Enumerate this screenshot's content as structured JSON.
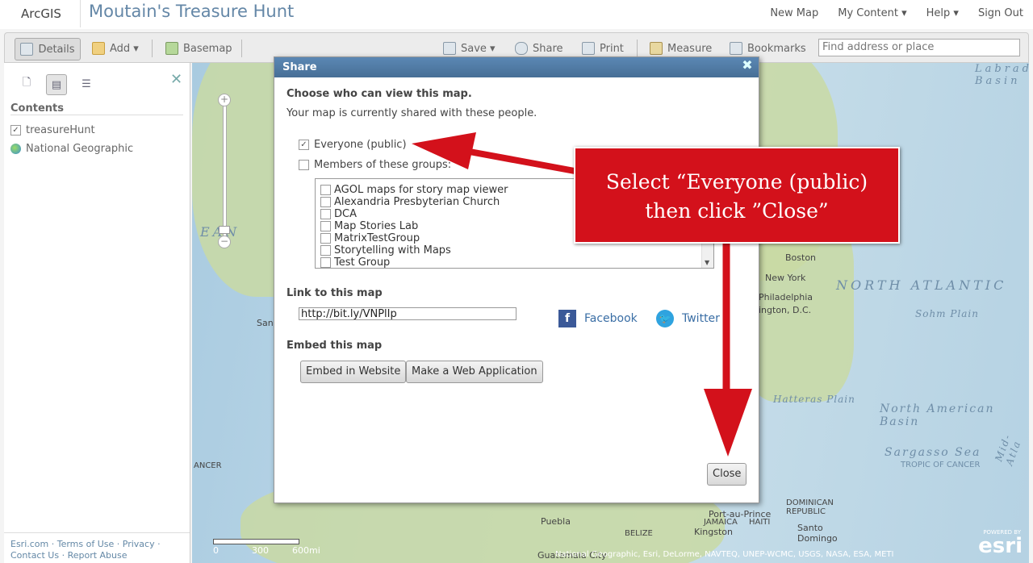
{
  "app": {
    "logo": "ArcGIS",
    "title": "Moutain's Treasure Hunt"
  },
  "topnav": [
    "New Map",
    "My Content ▾",
    "Help ▾",
    "Sign Out"
  ],
  "toolbar": {
    "details": "Details",
    "add": "Add ▾",
    "basemap": "Basemap",
    "save": "Save ▾",
    "share": "Share",
    "print": "Print",
    "measure": "Measure",
    "bookmarks": "Bookmarks",
    "search_placeholder": "Find address or place"
  },
  "sidebar": {
    "contents_heading": "Contents",
    "layers": [
      "treasureHunt",
      "National Geographic"
    ],
    "footer_line1": "Esri.com · Terms of Use · Privacy ·",
    "footer_line2": "Contact Us · Report Abuse"
  },
  "map": {
    "labels": [
      "Labrador Basin",
      "NORTH ATLANTIC",
      "Sohm Plain",
      "Hatteras Plain",
      "North American Basin",
      "Sargasso Sea",
      "TROPIC OF CANCER",
      "EAN",
      "Mid-Atla"
    ],
    "cities": [
      "Boston",
      "New York",
      "Philadelphia",
      "ington, D.C.",
      "San",
      "ANCER",
      "Puebla",
      "BELIZE",
      "JAMAICA",
      "Kingston",
      "HAITI",
      "Port-au-Prince",
      "DOMINICAN REPUBLIC",
      "Santo Domingo",
      "Guatemala City"
    ],
    "scale": [
      "0",
      "300",
      "600mi"
    ],
    "attribution": "National Geographic, Esri, DeLorme, NAVTEQ, UNEP-WCMC, USGS, NASA, ESA, METI",
    "esri_powered": "POWERED BY",
    "esri_logo": "esri"
  },
  "dialog": {
    "title": "Share",
    "heading": "Choose who can view this map.",
    "subtext": "Your map is currently shared with these people.",
    "opt_everyone": "Everyone (public)",
    "opt_groups": "Members of these groups:",
    "groups": [
      "AGOL maps for story map viewer",
      "Alexandria Presbyterian Church",
      "DCA",
      "Map Stories Lab",
      "MatrixTestGroup",
      "Storytelling with Maps",
      "Test Group"
    ],
    "link_heading": "Link to this map",
    "link_value": "http://bit.ly/VNPlIp",
    "facebook": "Facebook",
    "twitter": "Twitter",
    "embed_heading": "Embed this map",
    "embed_button": "Embed in Website",
    "webapp_button": "Make a Web Application",
    "close_button": "Close"
  },
  "annotation": {
    "line1": "Select “Everyone (public)",
    "line2": "then click ”Close”"
  },
  "colors": {
    "annotation_red": "#d3111b",
    "dialog_header": "#4f7ba5"
  }
}
